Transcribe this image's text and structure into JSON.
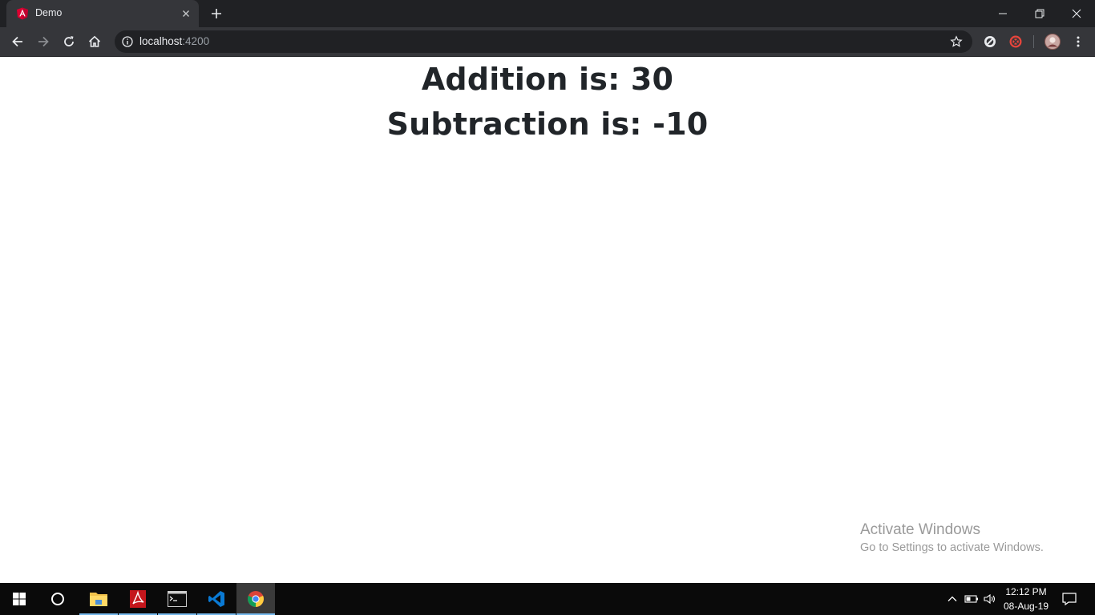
{
  "browser": {
    "tab_title": "Demo",
    "url_host": "localhost",
    "url_port": ":4200"
  },
  "page": {
    "addition_text": "Addition is: 30",
    "subtraction_text": "Subtraction is: -10"
  },
  "watermark": {
    "line1": "Activate Windows",
    "line2": "Go to Settings to activate Windows."
  },
  "taskbar": {
    "time": "12:12 PM",
    "date": "08-Aug-19"
  },
  "colors": {
    "angular_red": "#dd0031",
    "chrome_dark": "#202124",
    "toolbar": "#35363a",
    "heading_text": "#212529",
    "taskbar_accent": "#76b9ed"
  }
}
